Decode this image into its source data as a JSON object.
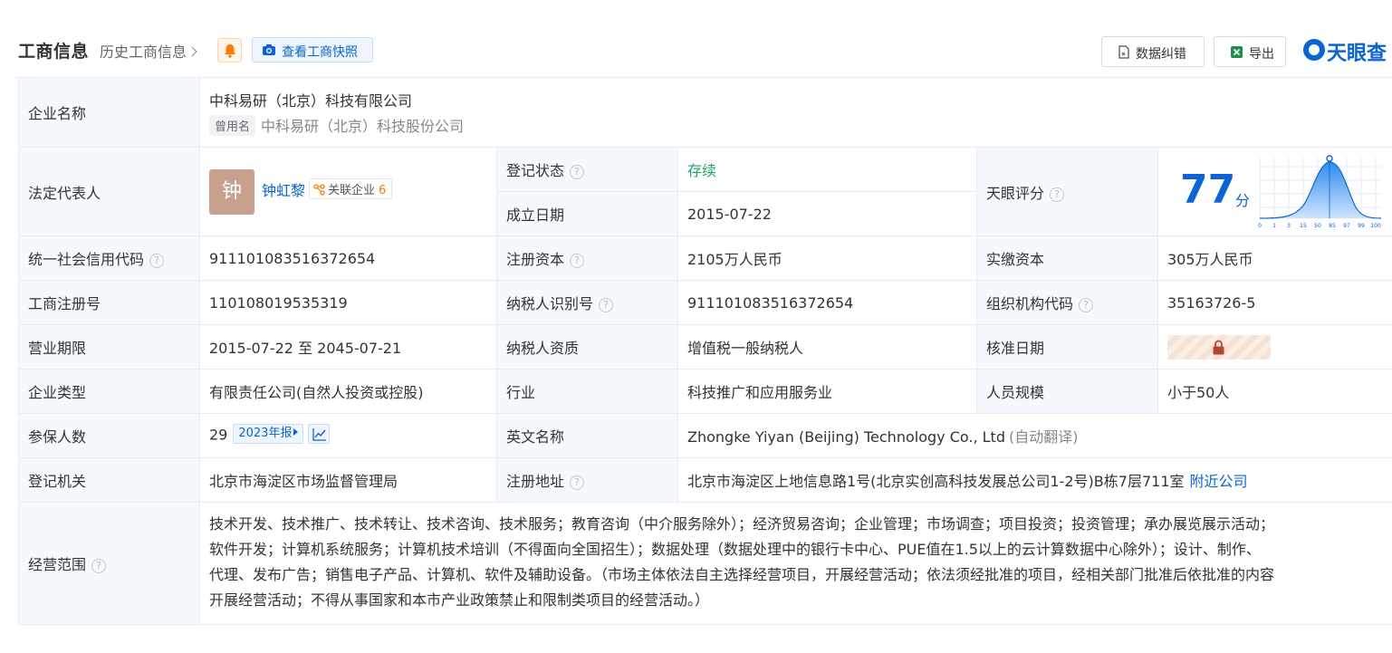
{
  "header": {
    "title": "工商信息",
    "history_label": "历史工商信息",
    "snapshot_label": "查看工商快照",
    "correction_label": "数据纠错",
    "export_label": "导出",
    "logo_text": "天眼查"
  },
  "company": {
    "name_label": "企业名称",
    "name": "中科易研（北京）科技有限公司",
    "former_tag": "曾用名",
    "former_name": "中科易研（北京）科技股份公司"
  },
  "legal_rep": {
    "label": "法定代表人",
    "avatar_char": "钟",
    "name": "钟虹黎",
    "assoc_label": "关联企业",
    "assoc_count": "6"
  },
  "status": {
    "label": "登记状态",
    "value": "存续"
  },
  "founded": {
    "label": "成立日期",
    "value": "2015-07-22"
  },
  "tianyan_score": {
    "label": "天眼评分",
    "value": "77",
    "unit": "分",
    "axis_ticks": [
      "0",
      "1",
      "3",
      "15",
      "50",
      "85",
      "97",
      "99",
      "100"
    ]
  },
  "credit_code": {
    "label": "统一社会信用代码",
    "value": "911101083516372654"
  },
  "reg_capital": {
    "label": "注册资本",
    "value": "2105万人民币"
  },
  "paid_capital": {
    "label": "实缴资本",
    "value": "305万人民币"
  },
  "reg_number": {
    "label": "工商注册号",
    "value": "110108019535319"
  },
  "taxpayer_id": {
    "label": "纳税人识别号",
    "value": "911101083516372654"
  },
  "org_code": {
    "label": "组织机构代码",
    "value": "35163726-5"
  },
  "term": {
    "label": "营业期限",
    "value": "2015-07-22 至 2045-07-21"
  },
  "taxpayer_qual": {
    "label": "纳税人资质",
    "value": "增值税一般纳税人"
  },
  "approval_date": {
    "label": "核准日期"
  },
  "company_type": {
    "label": "企业类型",
    "value": "有限责任公司(自然人投资或控股)"
  },
  "industry": {
    "label": "行业",
    "value": "科技推广和应用服务业"
  },
  "staff_size": {
    "label": "人员规模",
    "value": "小于50人"
  },
  "insured": {
    "label": "参保人数",
    "value": "29",
    "year_tag": "2023年报"
  },
  "english_name": {
    "label": "英文名称",
    "value": "Zhongke Yiyan (Beijing) Technology Co., Ltd",
    "auto_label": "(自动翻译)"
  },
  "reg_authority": {
    "label": "登记机关",
    "value": "北京市海淀区市场监督管理局"
  },
  "reg_address": {
    "label": "注册地址",
    "value": "北京市海淀区上地信息路1号(北京实创高科技发展总公司1-2号)B栋7层711室",
    "nearby_label": "附近公司"
  },
  "scope": {
    "label": "经营范围",
    "lines": [
      "技术开发、技术推广、技术转让、技术咨询、技术服务；教育咨询（中介服务除外）；经济贸易咨询；企业管理；市场调查；项目投资；投资管理；承办展览展示活动；",
      "软件开发；计算机系统服务；计算机技术培训（不得面向全国招生）；数据处理（数据处理中的银行卡中心、PUE值在1.5以上的云计算数据中心除外）；设计、制作、",
      "代理、发布广告；销售电子产品、计算机、软件及辅助设备。（市场主体依法自主选择经营项目，开展经营活动；依法须经批准的项目，经相关部门批准后依批准的内容",
      "开展经营活动；不得从事国家和本市产业政策禁止和限制类项目的经营活动。）"
    ]
  },
  "colors": {
    "accent": "#0a64d8",
    "status_ok": "#21a366",
    "label_bg": "#f5f8fc",
    "border": "#e8ecf1",
    "assoc_count": "#ff7a00"
  }
}
